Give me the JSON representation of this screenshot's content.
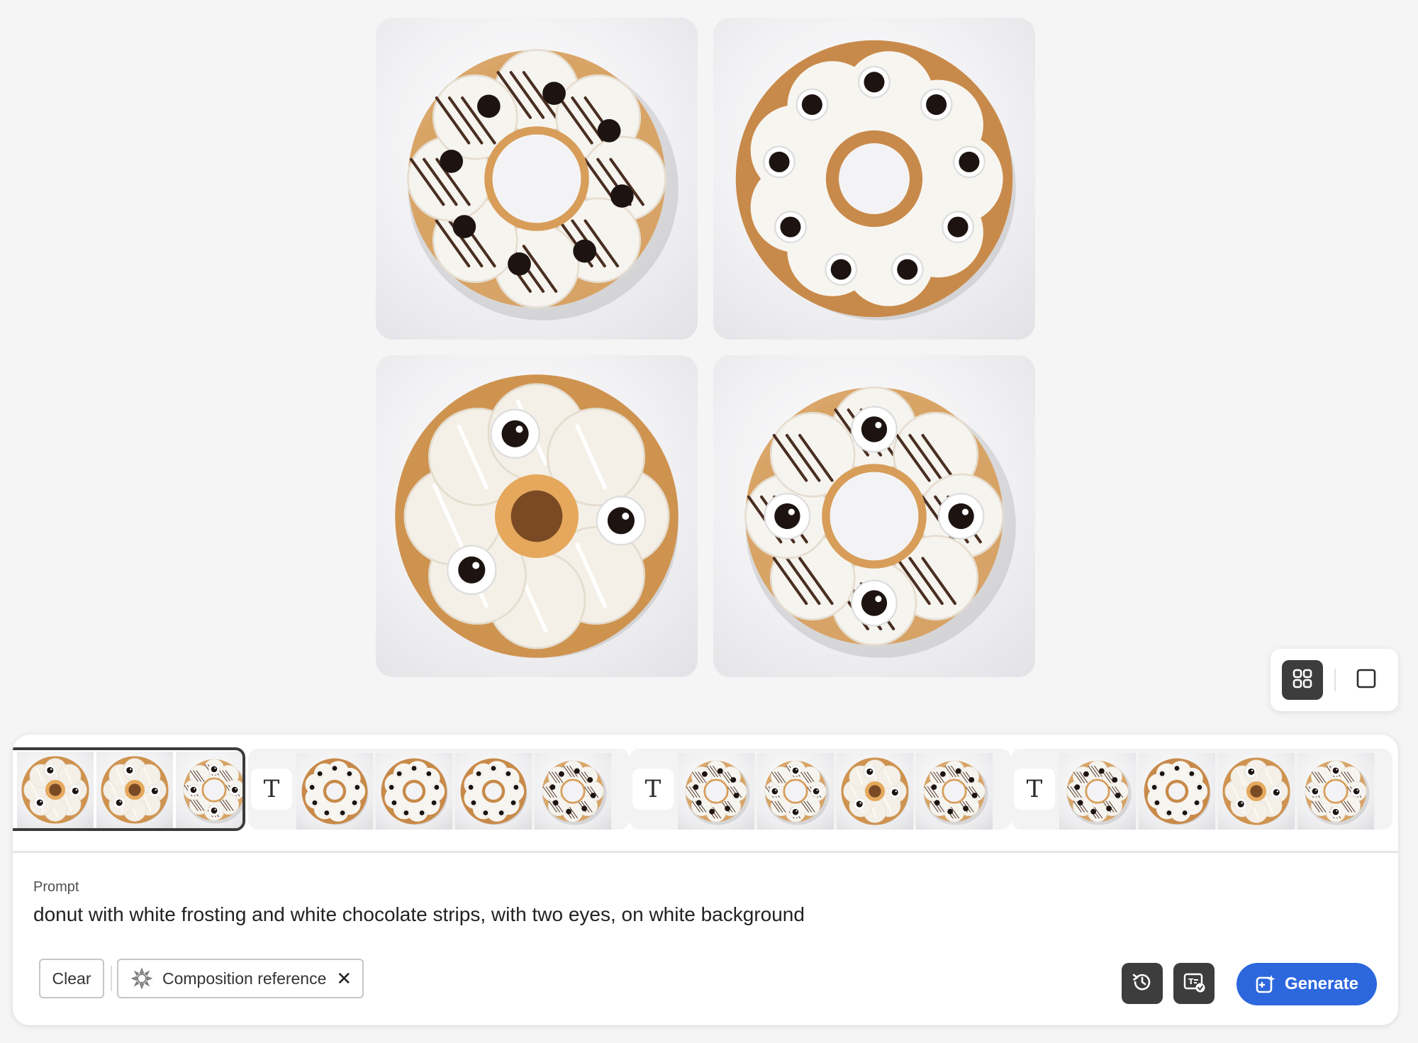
{
  "main_grid": {
    "images": [
      {
        "name": "generated-image-1",
        "style": "pon-de-ring",
        "frosting": "#f6f4ef",
        "dough": "#d79d59",
        "eyes": "dots",
        "stripes": true
      },
      {
        "name": "generated-image-2",
        "style": "flower",
        "frosting": "#f7f5f0",
        "dough": "#c88a4a",
        "eyes": "small-eyes",
        "stripes": false
      },
      {
        "name": "generated-image-3",
        "style": "ring-balls",
        "frosting": "#f4f0e8",
        "dough": "#cf9350",
        "eyes": "big-eyes-3",
        "stripes": true
      },
      {
        "name": "generated-image-4",
        "style": "pon-de-ring",
        "frosting": "#f6f4ef",
        "dough": "#d79d59",
        "eyes": "big-eyes-4",
        "stripes": true
      }
    ]
  },
  "view_toggle": {
    "grid_icon": "grid-view-icon",
    "single_icon": "single-view-icon",
    "selected": "grid"
  },
  "history": {
    "groups": [
      {
        "selected": true,
        "has_text_badge": false,
        "thumbs": 3
      },
      {
        "selected": false,
        "has_text_badge": true,
        "badge": "T",
        "thumbs": 4
      },
      {
        "selected": false,
        "has_text_badge": true,
        "badge": "T",
        "thumbs": 4
      },
      {
        "selected": false,
        "has_text_badge": true,
        "badge": "T",
        "thumbs": 4
      }
    ]
  },
  "prompt": {
    "label": "Prompt",
    "text": "donut with white frosting and white chocolate strips, with two eyes, on white background"
  },
  "controls": {
    "clear_label": "Clear",
    "composition_chip_label": "Composition reference",
    "composition_icon": "composition-reference-icon",
    "remove_icon": "close-icon",
    "history_icon": "history-icon",
    "match_icon": "style-match-icon",
    "generate_label": "Generate",
    "generate_icon": "generate-sparkle-icon"
  },
  "colors": {
    "accent": "#2c67dd",
    "dark_button": "#3d3d3d",
    "background": "#f5f5f5"
  }
}
